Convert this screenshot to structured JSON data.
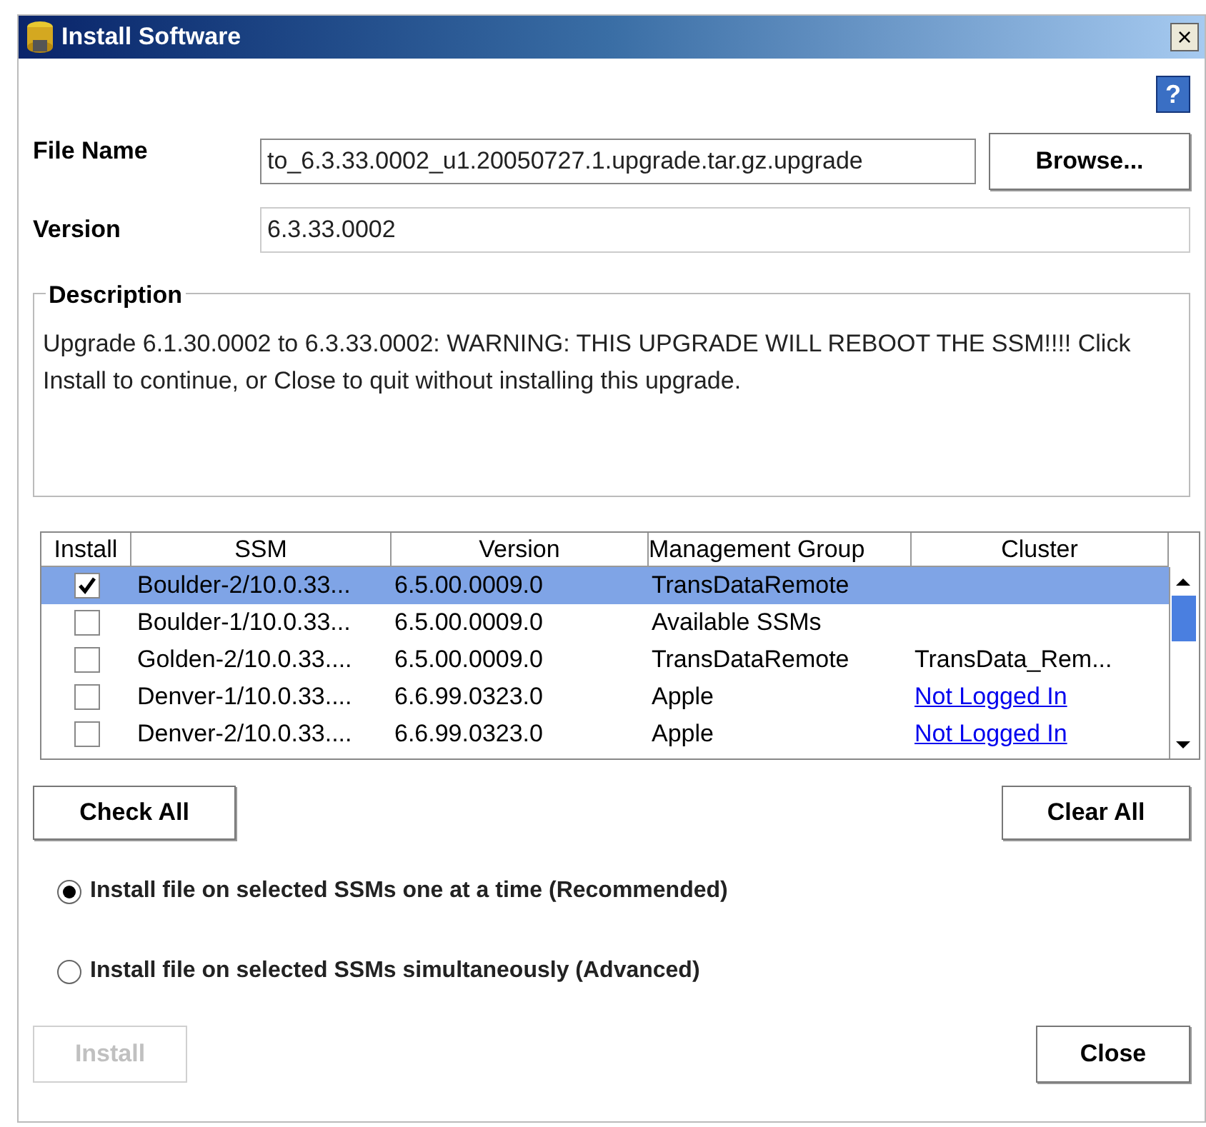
{
  "window": {
    "title": "Install Software",
    "close": "×"
  },
  "help": "?",
  "file_name": {
    "label": "File Name",
    "value": "to_6.3.33.0002_u1.20050727.1.upgrade.tar.gz.upgrade",
    "browse": "Browse..."
  },
  "version": {
    "label": "Version",
    "value": "6.3.33.0002"
  },
  "description": {
    "title": "Description",
    "text": "Upgrade 6.1.30.0002 to 6.3.33.0002: WARNING:  THIS UPGRADE WILL REBOOT THE SSM!!!!  Click Install to continue, or Close to quit without installing this upgrade."
  },
  "table": {
    "columns": [
      "Install",
      "SSM",
      "Version",
      "Management Group",
      "Cluster"
    ],
    "rows": [
      {
        "checked": true,
        "selected": true,
        "ssm": "Boulder-2/10.0.33...",
        "version": "6.5.00.0009.0",
        "group": "TransDataRemote"
      },
      {
        "checked": false,
        "selected": false,
        "ssm": "Boulder-1/10.0.33...",
        "version": "6.5.00.0009.0",
        "group": "Available SSMs"
      },
      {
        "checked": false,
        "selected": false,
        "ssm": "Golden-2/10.0.33....",
        "version": "6.5.00.0009.0",
        "group": "TransDataRemote",
        "cluster": {
          "kind": "text",
          "text": "TransData_Rem..."
        }
      },
      {
        "checked": false,
        "selected": false,
        "ssm": "Denver-1/10.0.33....",
        "version": "6.6.99.0323.0",
        "group": "Apple",
        "cluster": {
          "kind": "link",
          "text": "Not Logged In"
        }
      },
      {
        "checked": false,
        "selected": false,
        "ssm": "Denver-2/10.0.33....",
        "version": "6.6.99.0323.0",
        "group": "Apple",
        "cluster": {
          "kind": "link",
          "text": "Not Logged In"
        }
      }
    ]
  },
  "check_all": "Check All",
  "clear_all": "Clear All",
  "options": [
    {
      "label": "Install file on selected SSMs one at a time (Recommended)",
      "selected": true
    },
    {
      "label": "Install file on selected SSMs simultaneously (Advanced)",
      "selected": false
    }
  ],
  "buttons": [
    {
      "label": "Install",
      "disabled": true
    },
    {
      "label": "Close",
      "disabled": false
    }
  ]
}
